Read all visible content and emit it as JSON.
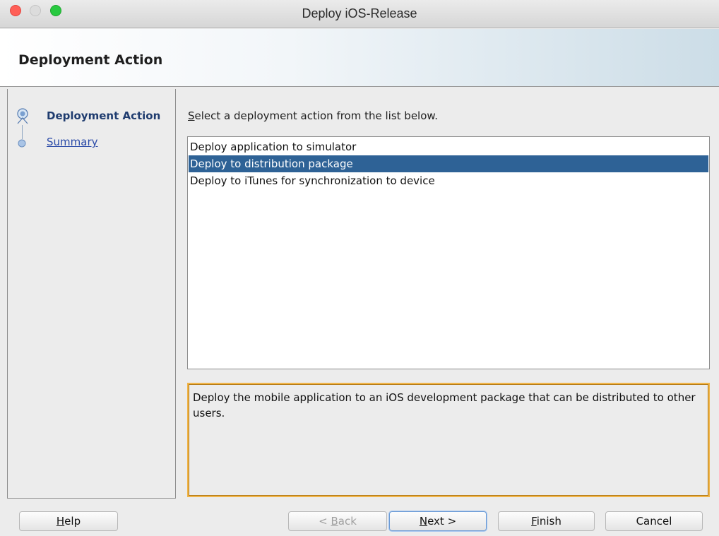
{
  "window": {
    "title": "Deploy iOS-Release"
  },
  "banner": {
    "title": "Deployment Action"
  },
  "nav": {
    "steps": [
      {
        "label": "Deployment Action",
        "state": "active",
        "icon": "step-active-icon"
      },
      {
        "label": "Summary",
        "state": "link",
        "icon": "step-dot-icon"
      }
    ]
  },
  "main": {
    "instruction_mnemonic": "S",
    "instruction_rest": "elect a deployment action from the list below.",
    "actions": [
      {
        "label": "Deploy application to simulator",
        "selected": false
      },
      {
        "label": "Deploy to distribution package",
        "selected": true
      },
      {
        "label": "Deploy to iTunes for synchronization to device",
        "selected": false
      }
    ],
    "description": "Deploy the mobile application to an iOS development package that can be distributed to other users."
  },
  "buttons": {
    "help": {
      "mnemonic": "H",
      "rest": "elp"
    },
    "back": {
      "prefix": "< ",
      "mnemonic": "B",
      "rest": "ack",
      "enabled": false
    },
    "next": {
      "mnemonic": "N",
      "rest": "ext >",
      "default": true
    },
    "finish": {
      "mnemonic": "F",
      "rest": "inish"
    },
    "cancel": {
      "label": "Cancel"
    }
  },
  "colors": {
    "selection": "#2e6296",
    "description_border": "#f0b54a",
    "close": "#ff5f57",
    "maximize": "#28c940"
  }
}
